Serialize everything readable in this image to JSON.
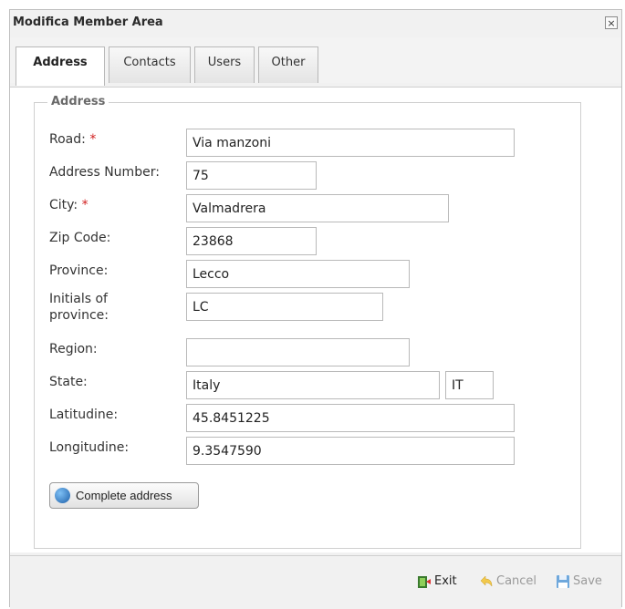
{
  "window": {
    "title": "Modifica Member Area",
    "close_label": "×"
  },
  "tabs": [
    {
      "label": "Address"
    },
    {
      "label": "Contacts"
    },
    {
      "label": "Users"
    },
    {
      "label": "Other"
    }
  ],
  "address": {
    "legend": "Address",
    "road": {
      "label": "Road:",
      "value": "Via manzoni",
      "required": "*"
    },
    "number": {
      "label": "Address Number:",
      "value": "75"
    },
    "city": {
      "label": "City:",
      "value": "Valmadrera",
      "required": "*"
    },
    "zip": {
      "label": "Zip Code:",
      "value": "23868"
    },
    "province": {
      "label": "Province:",
      "value": "Lecco"
    },
    "initials": {
      "label_line1": "Initials of",
      "label_line2": "province:",
      "value": "LC"
    },
    "region": {
      "label": "Region:",
      "value": ""
    },
    "state": {
      "label": "State:",
      "value": "Italy",
      "code": "IT"
    },
    "latitude": {
      "label": "Latitudine:",
      "value": "45.8451225"
    },
    "longitude": {
      "label": "Longitudine:",
      "value": "9.3547590"
    },
    "complete_button": "Complete address"
  },
  "footer": {
    "exit": "Exit",
    "cancel": "Cancel",
    "save": "Save"
  }
}
